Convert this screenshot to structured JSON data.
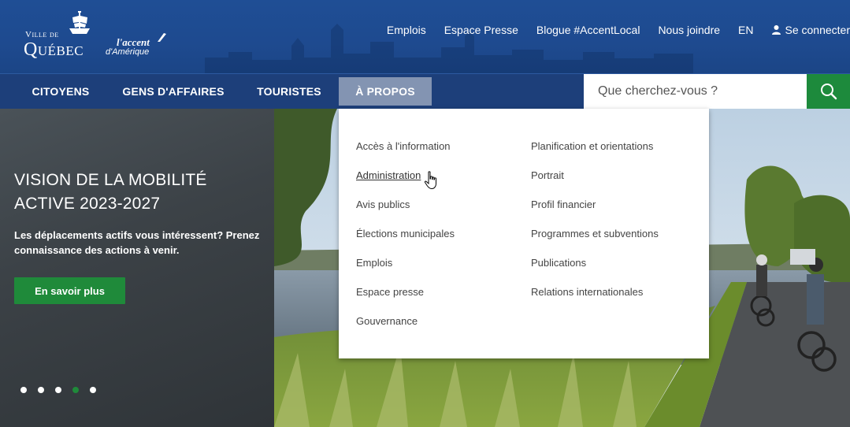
{
  "header": {
    "logo": {
      "ville_de": "Ville de",
      "quebec": "Québec",
      "accent": "l'accent",
      "amerique": "d'Amérique"
    },
    "utility_links": [
      {
        "label": "Emplois"
      },
      {
        "label": "Espace Presse"
      },
      {
        "label": "Blogue #AccentLocal"
      },
      {
        "label": "Nous joindre"
      },
      {
        "label": "EN"
      },
      {
        "label": "Se connecter",
        "icon": "user-icon"
      }
    ]
  },
  "nav": {
    "items": [
      {
        "label": "CITOYENS"
      },
      {
        "label": "GENS D'AFFAIRES"
      },
      {
        "label": "TOURISTES"
      },
      {
        "label": "À PROPOS",
        "active": true
      }
    ],
    "search": {
      "placeholder": "Que cherchez-vous ?",
      "icon": "search-icon"
    }
  },
  "dropdown": {
    "column1": [
      "Accès à l'information",
      "Administration",
      "Avis publics",
      "Élections municipales",
      "Emplois",
      "Espace presse",
      "Gouvernance"
    ],
    "column2": [
      "Planification et orientations",
      "Portrait",
      "Profil financier",
      "Programmes et subventions",
      "Publications",
      "Relations internationales"
    ],
    "hovered": "Administration"
  },
  "hero": {
    "title": "VISION DE LA MOBILITÉ ACTIVE 2023-2027",
    "description": "Les déplacements actifs vous intéressent? Prenez connaissance des actions à venir.",
    "cta_label": "En savoir plus",
    "slides_count": 5,
    "active_slide": 4
  },
  "colors": {
    "header_blue": "#1f4e95",
    "nav_blue": "#1d3f7a",
    "active_tab": "#8394b2",
    "green": "#1f8a3a",
    "hero_panel": "#3c4247"
  }
}
